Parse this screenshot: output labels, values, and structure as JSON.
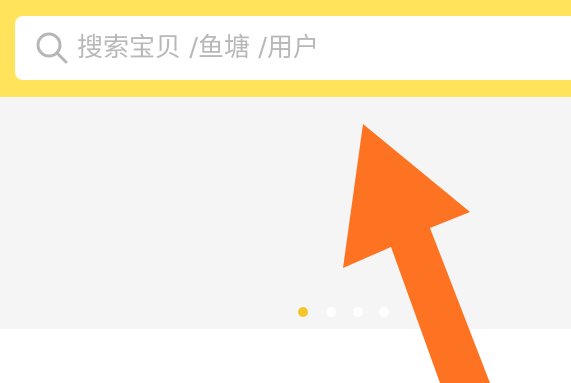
{
  "search": {
    "placeholder": "搜索宝贝 /鱼塘 /用户"
  },
  "banner": {
    "carousel_dots": 4,
    "active_index": 0
  },
  "colors": {
    "header_bg": "#ffe35a",
    "banner_bg": "#f5f5f5",
    "active_dot": "#f5c62a",
    "arrow": "#fd7322"
  },
  "icons": {
    "search": "search-icon",
    "annotation": "arrow-annotation-icon"
  }
}
